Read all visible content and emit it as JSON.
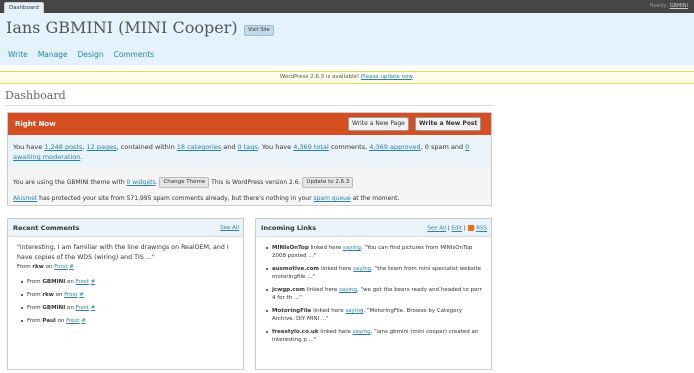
{
  "topbar": {
    "tab_label": "Dashboard",
    "howdy_text": "Howdy,",
    "user_name": "GBMINI"
  },
  "header": {
    "site_title": "Ians GBMINI (MINI Cooper)",
    "visit_site_label": "Visit Site",
    "nav": [
      "Write",
      "Manage",
      "Design",
      "Comments"
    ]
  },
  "update_nag": {
    "text": "WordPress 2.6.3 is available!",
    "link": "Please update now",
    "end": "."
  },
  "page_title": "Dashboard",
  "right_now": {
    "title": "Right Now",
    "write_page_label": "Write a New Page",
    "write_post_label": "Write a New Post",
    "stats": {
      "t1": "You have ",
      "posts": "1,248 posts",
      "t2": ", ",
      "pages": "12 pages",
      "t3": ", contained within ",
      "categories": "18 categories",
      "t4": " and ",
      "tags": "0 tags",
      "t5": ". You have ",
      "total": "4,369 total",
      "t6": " comments, ",
      "approved": "4,369 approved",
      "t7": ", 0 spam and ",
      "moderation": "0 awaiting moderation",
      "t8": "."
    },
    "theme": {
      "t1": "You are using the GBMINI theme with ",
      "widgets": "0 widgets",
      "t2": ".",
      "change_theme_label": "Change Theme",
      "t3": "This is WordPress version 2.6.",
      "update_label": "Update to 2.6.3"
    },
    "akismet": {
      "link": "Akismet",
      "t1": " has protected your site from 571,995 spam comments already, but there's nothing in your ",
      "queue": "spam queue",
      "t2": " at the moment."
    }
  },
  "recent_comments": {
    "title": "Recent Comments",
    "see_all": "See All",
    "quote": "\"interesting, I am familiar with the line drawings on RealOEM, and I have copies of the WDS (wiring) and TIS ...\"",
    "from_label": "From",
    "first_author": "rkw",
    "on_label": "on",
    "post_link": "Frost",
    "hash": "#",
    "items": [
      {
        "from": "From",
        "author": "GBMINI",
        "on": "on",
        "post": "Frost",
        "hash": "#"
      },
      {
        "from": "From",
        "author": "rkw",
        "on": "on",
        "post": "Frost",
        "hash": "#"
      },
      {
        "from": "From",
        "author": "GBMINI",
        "on": "on",
        "post": "Frost",
        "hash": "#"
      },
      {
        "from": "From",
        "author": "Paul",
        "on": "on",
        "post": "Frost",
        "hash": "#"
      }
    ]
  },
  "incoming_links": {
    "title": "Incoming Links",
    "see_all": "See All",
    "edit": "Edit",
    "rss": "RSS",
    "sep": "|",
    "items": [
      {
        "name": "MINIsOnTop",
        "linked": "linked here",
        "link": "saying",
        "quote": ", \"You can find pictures from MINIsOnTop 2008 posted ...\""
      },
      {
        "name": "ausmotive.com",
        "linked": "linked here",
        "link": "saying",
        "quote": ", \"the team from mini specialist website motoringfile ...\""
      },
      {
        "name": "jcwgp.com",
        "linked": "linked here",
        "link": "saying",
        "quote": ", \"we got the bears ready and headed to perr 4 for th ...\""
      },
      {
        "name": "MotoringFile",
        "linked": "linked here",
        "link": "saying",
        "quote": ", \"MotoringFile. Browse by Category Archive. DIY MINI ...\""
      },
      {
        "name": "freestylo.co.uk",
        "linked": "linked here",
        "link": "saying",
        "quote": ", \"ians gbmini (mini cooper) created an interesting p ...\""
      }
    ]
  },
  "colors": {
    "header_bg": "#e4f2fd",
    "right_now_bar": "#d54e21",
    "link": "#2583ad",
    "nag_bg": "#fffeeb"
  }
}
